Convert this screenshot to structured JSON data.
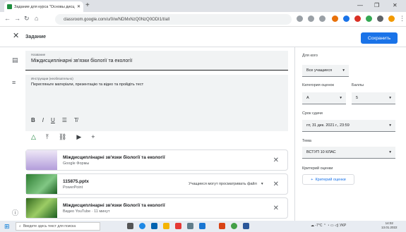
{
  "browser": {
    "tab_title": "Задание для курса \"Основы дисц",
    "url": "classroom.google.com/u/0/w/NDMxNzQ0NzQ0ODI1/t/all",
    "colors": {
      "tab_strip": "#dee1e6"
    }
  },
  "header": {
    "title": "Задание",
    "save_label": "Сохранить",
    "accent": "#1a73e8"
  },
  "main": {
    "title_label": "Название",
    "title_value": "Міждисциплінарні зв'язки біології та екології",
    "desc_label": "Инструкции (необязательно)",
    "desc_value": "Перегляньте матеріали, презентацію та відео та пройдіть тест",
    "format_buttons": [
      "B",
      "I",
      "U",
      "☰",
      "T̸"
    ],
    "attachments": [
      {
        "title": "Міждисциплінарні зв'язки біології та екології",
        "subtitle": "Google Формы"
      },
      {
        "title": "115875.pptx",
        "subtitle": "PowerPoint",
        "permission": "Учащиеся могут просматривать файл"
      },
      {
        "title": "Міждисциплінарні зв'язки біології та екології",
        "subtitle": "Видео YouTube · 11 минут"
      }
    ]
  },
  "panel": {
    "for_label": "Для кого",
    "for_value": "Все учащиеся",
    "category_label": "Категория оценок",
    "category_value": "А",
    "points_label": "Баллы",
    "points_value": "5",
    "due_label": "Срок сдачи",
    "due_value": "пт, 31 дек. 2021 г., 23:59",
    "topic_label": "Тема",
    "topic_value": "ВСТУП 10 КЛАС",
    "rubric_label": "Критерий оценки",
    "rubric_button": "Критерий оценки"
  },
  "taskbar": {
    "search_placeholder": "Введите здесь текст для поиска",
    "weather": "-7°C",
    "lang": "УКР",
    "time": "14:02",
    "date": "13.01.2022"
  }
}
